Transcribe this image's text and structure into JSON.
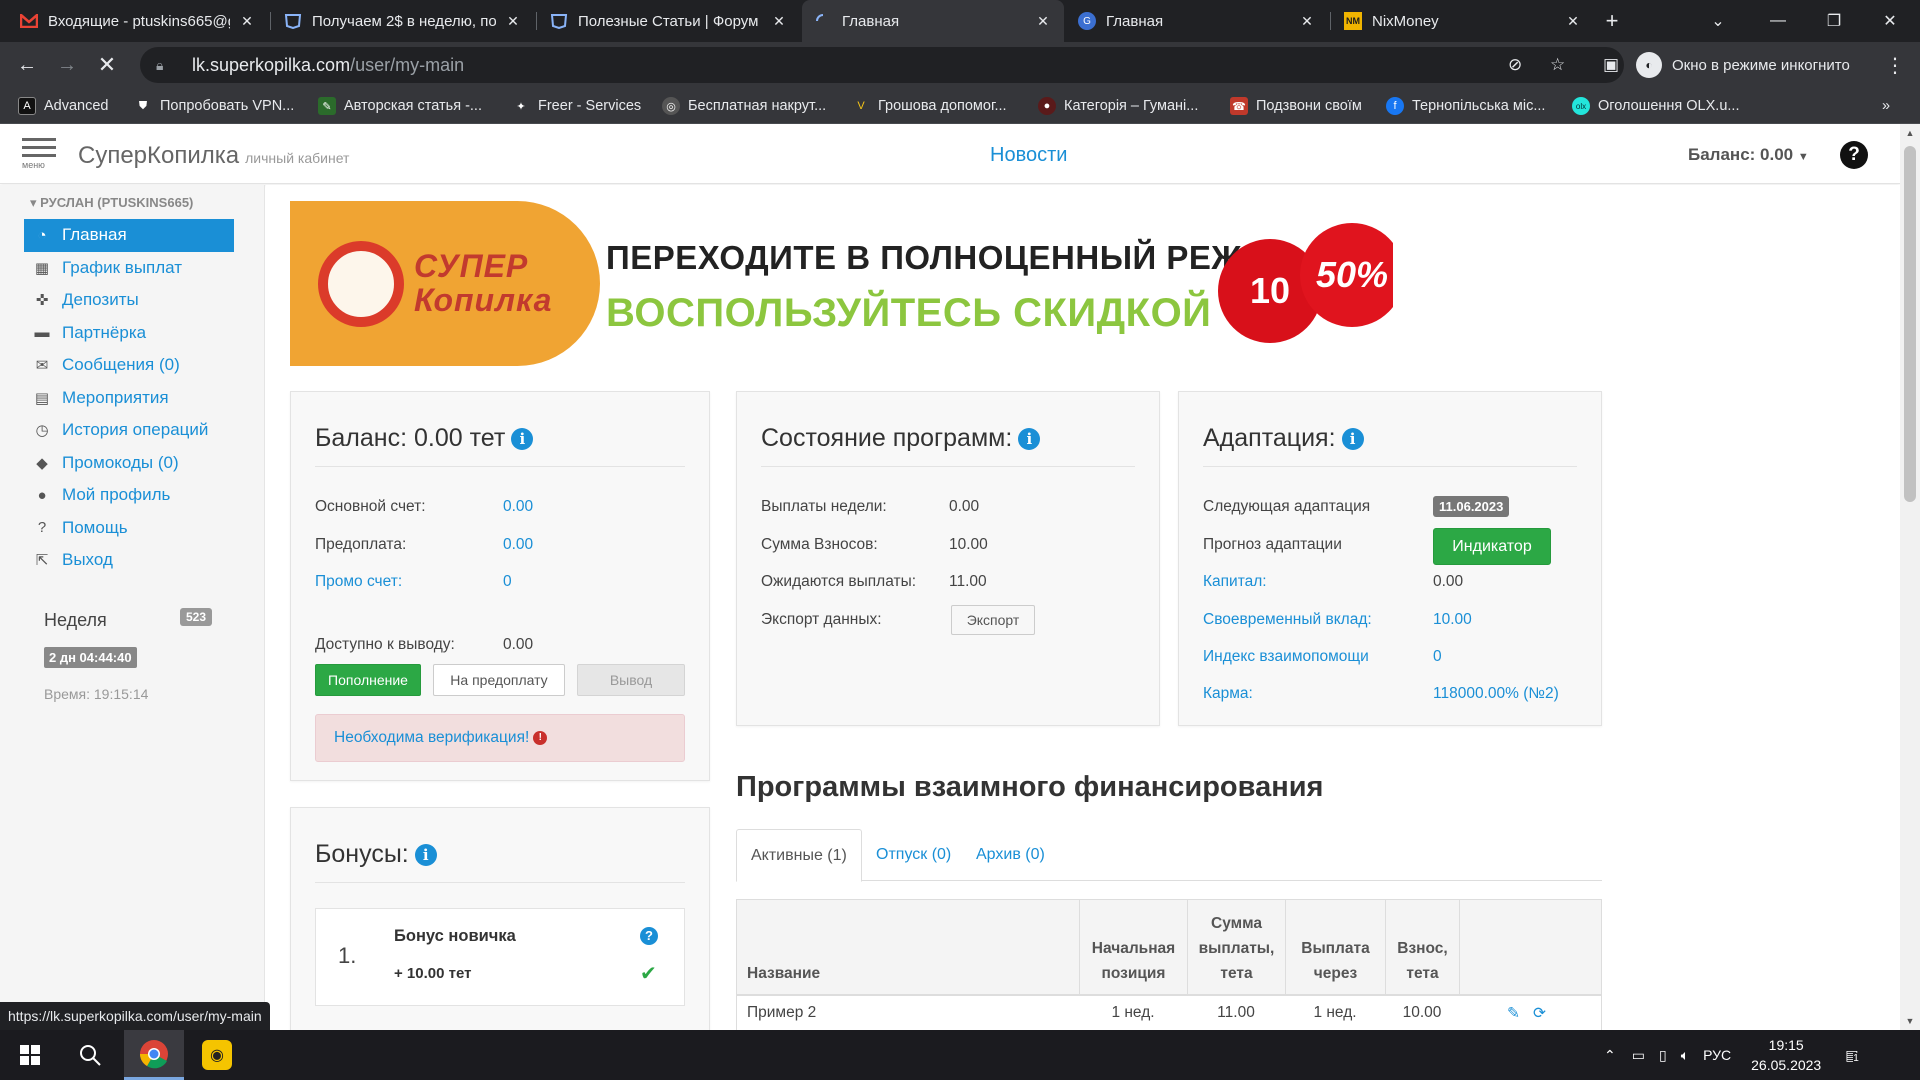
{
  "browser": {
    "tabs": [
      {
        "label": "Входящие - ptuskins665@g",
        "icon": "gmail-icon"
      },
      {
        "label": "Получаем 2$ в неделю, по",
        "icon": "forum-icon"
      },
      {
        "label": "Полезные Статьи | Форум",
        "icon": "forum-icon"
      },
      {
        "label": "Главная",
        "icon": "loading-icon"
      },
      {
        "label": "Главная",
        "icon": "site-icon"
      },
      {
        "label": "NixMoney",
        "icon": "nixmoney-icon"
      }
    ],
    "url_host": "lk.superkopilka.com",
    "url_path": "/user/my-main",
    "incognito_label": "Окно в режиме инкогнито",
    "bookmarks": [
      {
        "label": "Advanced"
      },
      {
        "label": "Попробовать VPN..."
      },
      {
        "label": "Авторская статья -..."
      },
      {
        "label": "Freer - Services"
      },
      {
        "label": "Бесплатная накрут..."
      },
      {
        "label": "Грошова допомог..."
      },
      {
        "label": "Категорія – Гумані..."
      },
      {
        "label": "Подзвони своїм"
      },
      {
        "label": "Тернопільська міс..."
      },
      {
        "label": "Оголошення OLX.u..."
      }
    ],
    "more_bookmarks": "»",
    "status_url": "https://lk.superkopilka.com/user/my-main"
  },
  "header": {
    "brand": "СуперКопилка",
    "brand_sub": "личный кабинет",
    "menu_label": "меню",
    "news": "Новости",
    "balance": "Баланс: 0.00",
    "help": "?"
  },
  "sidebar": {
    "user": "▾ РУСЛАН (PTUSKINS665)",
    "items": [
      {
        "label": "Главная",
        "icon": "dashboard-icon"
      },
      {
        "label": "График выплат",
        "icon": "calendar-icon"
      },
      {
        "label": "Депозиты",
        "icon": "crosshair-icon"
      },
      {
        "label": "Партнёрка",
        "icon": "briefcase-icon"
      },
      {
        "label": "Сообщения (0)",
        "icon": "envelope-icon"
      },
      {
        "label": "Мероприятия",
        "icon": "film-icon"
      },
      {
        "label": "История операций",
        "icon": "clock-icon"
      },
      {
        "label": "Промокоды (0)",
        "icon": "tag-icon"
      },
      {
        "label": "Мой профиль",
        "icon": "user-icon"
      },
      {
        "label": "Помощь",
        "icon": "question-icon"
      },
      {
        "label": "Выход",
        "icon": "logout-icon"
      }
    ],
    "week_label": "Неделя",
    "week_number": "523",
    "week_timer": "2 дн 04:44:40",
    "time": "Время: 19:15:14"
  },
  "banner": {
    "logo_line1": "СУПЕР",
    "logo_line2": "Копилка",
    "line1": "ПЕРЕХОДИТЕ В ПОЛНОЦЕННЫЙ РЕЖИМ,",
    "line2": "ВОСПОЛЬЗУЙТЕСЬ СКИДКОЙ",
    "tag1": "10",
    "tag2": "50%"
  },
  "balance_panel": {
    "title": "Баланс: 0.00 тет",
    "rows": [
      {
        "k": "Основной счет:",
        "v": "0.00"
      },
      {
        "k": "Предоплата:",
        "v": "0.00"
      },
      {
        "k": "Промо счет:",
        "v": "0"
      }
    ],
    "available_k": "Доступно к выводу:",
    "available_v": "0.00",
    "btn_topup": "Пополнение",
    "btn_prepay": "На предоплату",
    "btn_withdraw": "Вывод",
    "verify": "Необходима верификация!"
  },
  "programs_panel": {
    "title": "Состояние программ:",
    "rows": [
      {
        "k": "Выплаты недели:",
        "v": "0.00"
      },
      {
        "k": "Сумма Взносов:",
        "v": "10.00"
      },
      {
        "k": "Ожидаются выплаты:",
        "v": "11.00"
      },
      {
        "k": "Экспорт данных:",
        "v": ""
      }
    ],
    "export_btn": "Экспорт"
  },
  "adapt_panel": {
    "title": "Адаптация:",
    "next_k": "Следующая адаптация",
    "next_v": "11.06.2023",
    "forecast_k": "Прогноз адаптации",
    "forecast_btn": "Индикатор",
    "rows": [
      {
        "k": "Капитал:",
        "v": "0.00"
      },
      {
        "k": "Своевременный вклад:",
        "v": "10.00"
      },
      {
        "k": "Индекс взаимопомощи",
        "v": "0"
      },
      {
        "k": "Карма:",
        "v": "118000.00% (№2)"
      }
    ]
  },
  "bonus_panel": {
    "title": "Бонусы:",
    "number": "1.",
    "name": "Бонус новичка",
    "amount": "+ 10.00 тет"
  },
  "programs": {
    "title": "Программы взаимного финансирования",
    "tabs": [
      "Активные (1)",
      "Отпуск (0)",
      "Архив (0)"
    ],
    "columns": [
      "Название",
      "Начальная позиция",
      "Сумма выплаты, тета",
      "Выплата через",
      "Взнос, тета",
      ""
    ],
    "rows": [
      {
        "name": "Пример 2",
        "start": "1 нед.",
        "sum": "11.00",
        "through": "1 нед.",
        "fee": "10.00"
      }
    ]
  },
  "taskbar": {
    "lang": "РУС",
    "time": "19:15",
    "date": "26.05.2023",
    "notif": "1"
  },
  "colors": {
    "accent": "#1a8fd6",
    "green": "#2ca845",
    "alert_bg": "#f2dede"
  }
}
